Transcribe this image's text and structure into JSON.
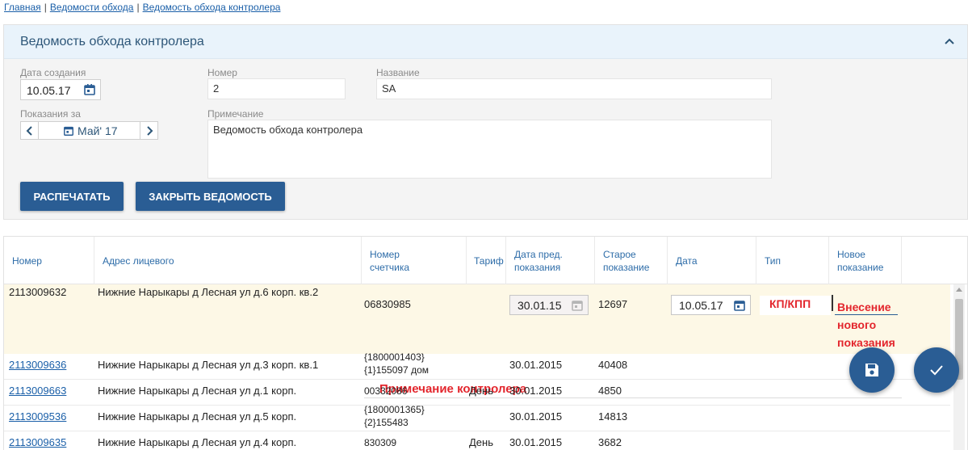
{
  "breadcrumb": {
    "items": [
      "Главная",
      "Ведомости обхода",
      "Ведомость обхода контролера"
    ],
    "separator": "|"
  },
  "panel": {
    "title": "Ведомость обхода контролера",
    "collapse_icon": "chevron-up-icon",
    "created_label": "Дата создания",
    "created_value": "10.05.17",
    "number_label": "Номер",
    "number_value": "2",
    "name_label": "Название",
    "name_value": "SA",
    "period_label": "Показания за",
    "period_value": "Май' 17",
    "note_label": "Примечание",
    "note_value": "Ведомость обхода контролера",
    "print_button": "РАСПЕЧАТАТЬ",
    "close_button": "ЗАКРЫТЬ ВЕДОМОСТЬ"
  },
  "table": {
    "headers": {
      "number": "Номер",
      "address": "Адрес лицевого",
      "meter_line1": "Номер",
      "meter_line2": "счетчика",
      "tariff": "Тариф",
      "prev_date_line1": "Дата пред.",
      "prev_date_line2": "показания",
      "old_line1": "Старое",
      "old_line2": "показание",
      "date": "Дата",
      "type": "Тип",
      "new_line1": "Новое",
      "new_line2": "показание"
    },
    "selected_row": {
      "number": "2113009632",
      "address": "Нижние Нарыкары д Лесная ул д.6 корп. кв.2",
      "meter": "06830985",
      "tariff": "",
      "prev_date": "30.01.15",
      "old_value": "12697",
      "date": "10.05.17",
      "type_annotation": "КП/КПП",
      "new_value_annotation_1": "Внесение",
      "new_value_annotation_2": "нового",
      "new_value_annotation_3": "показания",
      "note_annotation": "Примечание контролера"
    },
    "rows": [
      {
        "number": "2113009636",
        "address": "Нижние Нарыкары д Лесная ул д.3 корп. кв.1",
        "meter_line1": "{1800001403}",
        "meter_line2": "{1}155097 дом",
        "tariff": "",
        "prev_date": "30.01.2015",
        "old_value": "40408"
      },
      {
        "number": "2113009663",
        "address": "Нижние Нарыкары д Лесная ул д.1 корп.",
        "meter_line1": "00332086",
        "meter_line2": "",
        "tariff": "День",
        "prev_date": "30.01.2015",
        "old_value": "4850"
      },
      {
        "number": "2113009536",
        "address": "Нижние Нарыкары д Лесная ул д.5 корп.",
        "meter_line1": "{1800001365}",
        "meter_line2": "{2}155483",
        "tariff": "",
        "prev_date": "30.01.2015",
        "old_value": "14813"
      },
      {
        "number": "2113009635",
        "address": "Нижние Нарыкары д Лесная ул д.4 корп.",
        "meter_line1": "830309",
        "meter_line2": "",
        "tariff": "День",
        "prev_date": "30.01.2015",
        "old_value": "3682"
      }
    ]
  },
  "fabs": {
    "save_icon": "save-icon",
    "confirm_icon": "check-icon"
  },
  "colors": {
    "primary": "#2a5d94",
    "link": "#1a5fa8",
    "header_text": "#2d6ca8",
    "annotation": "#e3262d",
    "selected_row": "#fdf8e6",
    "panel_header": "#e9f3fb"
  }
}
